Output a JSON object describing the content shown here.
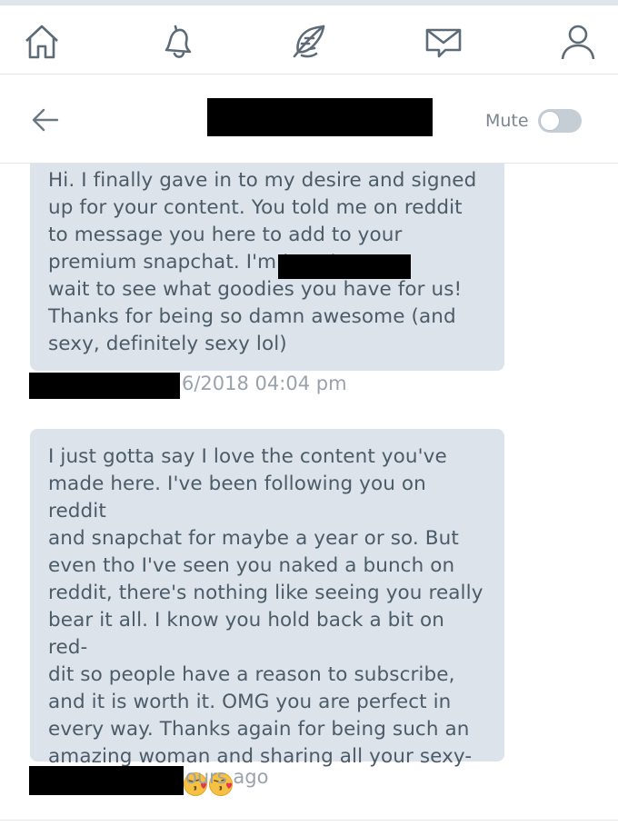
{
  "nav": {
    "icons": [
      "home-icon",
      "bell-icon",
      "feather-icon",
      "mail-icon",
      "user-icon"
    ]
  },
  "header": {
    "title": "",
    "mute_label": "Mute",
    "mute_on": false
  },
  "messages": [
    {
      "text": "Hi. I finally gave in to my desire and signed\nup for your content. You told me on reddit\nto message you here to add to your\npremium snapchat. I'm                                     I can't\nwait to see what goodies you have for us!\nThanks for being so damn awesome (and\nsexy, definitely sexy lol)",
      "timestamp": "6/2018 04:04 pm"
    },
    {
      "text": "I just gotta say I love the content you've\nmade here. I've been following you on reddit\nand snapchat for maybe a year or so. But\neven tho I've seen you naked a bunch on\nreddit, there's nothing like seeing you really\nbear it all. I know you hold back a bit on red-\ndit so people have a reason to subscribe,\nand it is worth it. OMG you are perfect in\nevery way. Thanks again for being such an\namazing woman and sharing all your sexy-\nness with us. ",
      "emojis": [
        "kissing-heart-emoji",
        "kissing-heart-emoji"
      ],
      "timestamp": "ours ago"
    }
  ],
  "colors": {
    "bubble": "#dce3ea",
    "text": "#4b5b68",
    "meta": "#9aa3ab",
    "icon": "#5c6b76"
  }
}
